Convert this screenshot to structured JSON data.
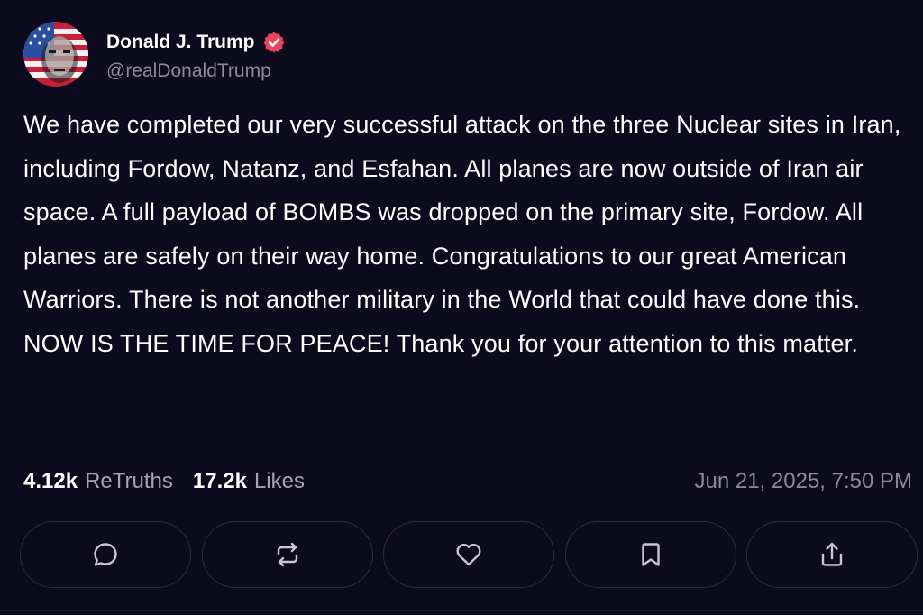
{
  "post": {
    "author": {
      "display_name": "Donald J. Trump",
      "handle": "@realDonaldTrump",
      "verified": true,
      "avatar_icon": "avatar-flag-face",
      "verified_icon": "verified-badge-icon"
    },
    "text": "We have completed our very successful attack on the three Nuclear sites in Iran, including Fordow, Natanz, and Esfahan. All planes are now outside of Iran air space. A full payload of BOMBS was dropped on the primary site, Fordow. All planes are safely on their way home. Congratulations to our great American Warriors. There is not another military in the World that could have done this. NOW IS THE TIME FOR PEACE! Thank you for your attention to this matter.",
    "stats": {
      "retruths_count": "4.12k",
      "retruths_label": "ReTruths",
      "likes_count": "17.2k",
      "likes_label": "Likes"
    },
    "timestamp": "Jun 21, 2025, 7:50 PM"
  },
  "actions": [
    {
      "name": "reply",
      "icon": "comment-icon"
    },
    {
      "name": "retruth",
      "icon": "repost-icon"
    },
    {
      "name": "like",
      "icon": "heart-icon"
    },
    {
      "name": "bookmark",
      "icon": "bookmark-icon"
    },
    {
      "name": "share",
      "icon": "share-icon"
    }
  ],
  "colors": {
    "background": "#0c0a1d",
    "text_primary": "#ffffff",
    "text_secondary": "#8d8a9c",
    "button_border": "#2f2c45",
    "verified_badge": "#e5455d"
  }
}
